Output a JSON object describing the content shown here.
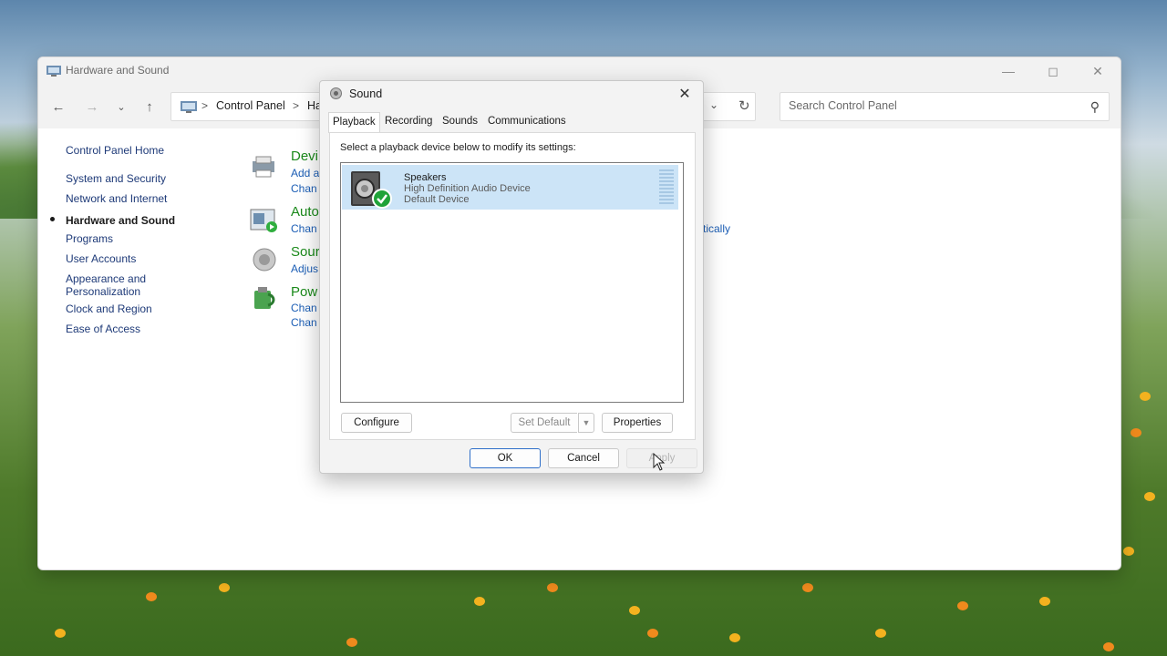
{
  "control_panel": {
    "title": "Hardware and Sound",
    "breadcrumb": [
      "Control Panel",
      "Ha"
    ],
    "search_placeholder": "Search Control Panel",
    "sidebar": [
      {
        "label": "Control Panel Home"
      },
      {
        "label": "System and Security"
      },
      {
        "label": "Network and Internet"
      },
      {
        "label": "Hardware and Sound",
        "active": true
      },
      {
        "label": "Programs"
      },
      {
        "label": "User Accounts"
      },
      {
        "label": "Appearance and Personalization"
      },
      {
        "label": "Clock and Region"
      },
      {
        "label": "Ease of Access"
      }
    ],
    "categories": [
      {
        "title": "Devi",
        "links": [
          "Add a",
          "Chan"
        ]
      },
      {
        "title": "Auto",
        "links": [
          "Chan"
        ],
        "extra_link": "tically"
      },
      {
        "title": "Sour",
        "links": [
          "Adjus"
        ]
      },
      {
        "title": "Pow",
        "links": [
          "Chan",
          "Chan"
        ]
      }
    ]
  },
  "sound_dialog": {
    "title": "Sound",
    "tabs": [
      "Playback",
      "Recording",
      "Sounds",
      "Communications"
    ],
    "active_tab": "Playback",
    "instruction": "Select a playback device below to modify its settings:",
    "device": {
      "name": "Speakers",
      "description": "High Definition Audio Device",
      "status": "Default Device"
    },
    "buttons": {
      "configure": "Configure",
      "set_default": "Set Default",
      "properties": "Properties",
      "ok": "OK",
      "cancel": "Cancel",
      "apply": "Apply"
    }
  },
  "colors": {
    "link": "#1c5eb5",
    "category_title": "#1b8a1b",
    "selection": "#cce4f7",
    "check_green": "#1fa339"
  }
}
